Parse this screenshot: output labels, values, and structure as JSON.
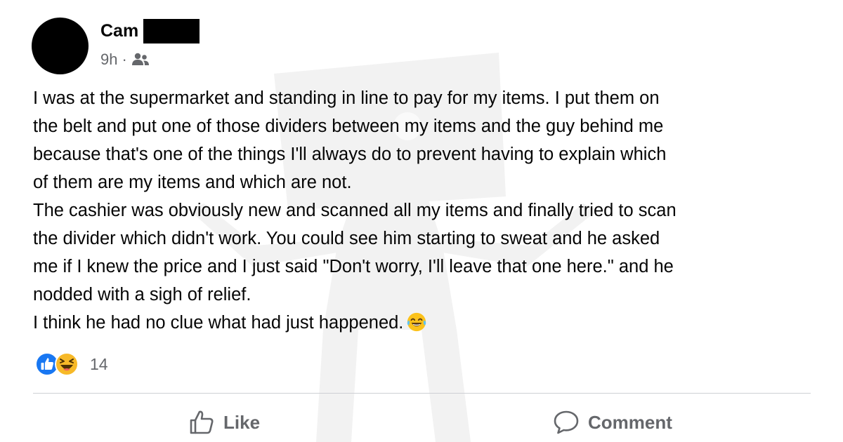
{
  "post": {
    "author": "Cam",
    "time": "9h",
    "separator": "·",
    "audience_icon": "friends-icon",
    "lines": [
      "I was at the supermarket and standing in line to pay for my items. I put them on",
      "the belt and put one of those dividers between my items and the guy behind me",
      "because that's one of the things I'll always do to prevent having to explain which",
      "of them are my items and which are not.",
      "The cashier was obviously new and scanned all my items and finally tried to scan",
      "the divider which didn't work. You could see him starting to sweat and he asked",
      "me if I knew the price and I just said \"Don't worry, I'll leave that one here.\" and he",
      "nodded with a sigh of relief.",
      "I think he had no clue what had just happened."
    ],
    "end_emoji": "tears-of-joy-emoji"
  },
  "reactions": {
    "types": [
      "like",
      "haha"
    ],
    "count": "14"
  },
  "actions": {
    "like_label": "Like",
    "comment_label": "Comment"
  },
  "colors": {
    "secondary_text": "#65676b",
    "like_blue": "#1877f2",
    "haha_yellow": "#f7b928",
    "divider": "#ced0d4"
  }
}
